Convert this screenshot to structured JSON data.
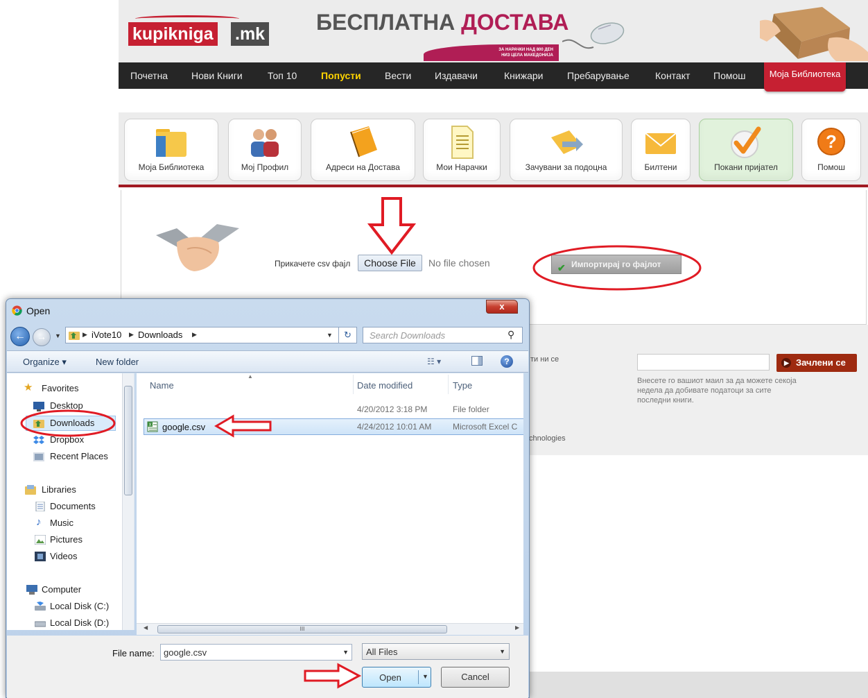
{
  "site": {
    "logo_main": "kupikniga",
    "logo_tld": ".mk",
    "promo_part1": "БЕСПЛАТНА",
    "promo_part2": "ДОСТАВА",
    "promo_sub_line1": "ЗА НАРАЧКИ НАД 800 ДЕН",
    "promo_sub_line2": "НИЗ ЦЕЛА МАКЕДОНИЈА",
    "nav": [
      "Почетна",
      "Нови Книги",
      "Топ 10",
      "Попусти",
      "Вести",
      "Издавачи",
      "Книжари",
      "Пребарување",
      "Контакт",
      "Помош"
    ],
    "nav_active": "Попусти",
    "nav_library": "Моја Библиотека",
    "tabs": [
      "Моја Библиотека",
      "Мој Профил",
      "Адреси на Достава",
      "Мои Нарачки",
      "Зачувани за подоцна",
      "Билтени",
      "Покани пријател",
      "Помош"
    ],
    "tab_active": "Покани пријател",
    "attach_label": "Прикачете csv фајл",
    "choose_file": "Choose File",
    "no_file": "No file chosen",
    "import_button": "Импортирај го фајлот",
    "newsletter_partial": "ти ни се",
    "newsletter_button": "Зачлени се",
    "newsletter_text": "Внесете го вашиот маил за да можете секоја недела да добивате податоци за сите последни книги.",
    "footer_partial": "chnologies"
  },
  "dialog": {
    "title": "Open",
    "close": "x",
    "breadcrumb": [
      "iVote10",
      "Downloads"
    ],
    "search_placeholder": "Search Downloads",
    "organize": "Organize ▾",
    "new_folder": "New folder",
    "nav_favorites": "Favorites",
    "nav_desktop": "Desktop",
    "nav_downloads": "Downloads",
    "nav_dropbox": "Dropbox",
    "nav_recent": "Recent Places",
    "nav_libraries": "Libraries",
    "nav_documents": "Documents",
    "nav_music": "Music",
    "nav_pictures": "Pictures",
    "nav_videos": "Videos",
    "nav_computer": "Computer",
    "nav_disk_c": "Local Disk (C:)",
    "nav_disk_d": "Local Disk (D:)",
    "columns": {
      "name": "Name",
      "date": "Date modified",
      "type": "Type"
    },
    "rows": [
      {
        "name": "",
        "date": "4/20/2012 3:18 PM",
        "type": "File folder"
      },
      {
        "name": "google.csv",
        "date": "4/24/2012 10:01 AM",
        "type": "Microsoft Excel C"
      }
    ],
    "file_name_label": "File name:",
    "file_name_value": "google.csv",
    "file_type": "All Files",
    "open_button": "Open",
    "cancel_button": "Cancel",
    "scroll_grip": "III"
  },
  "colors": {
    "brand_red": "#c62032",
    "nav_bg": "#262626",
    "nav_active": "#ffd400",
    "annotation_red": "#e01b24",
    "dialog_frame": "#bcd1ea",
    "selection": "#cfe4f8"
  }
}
